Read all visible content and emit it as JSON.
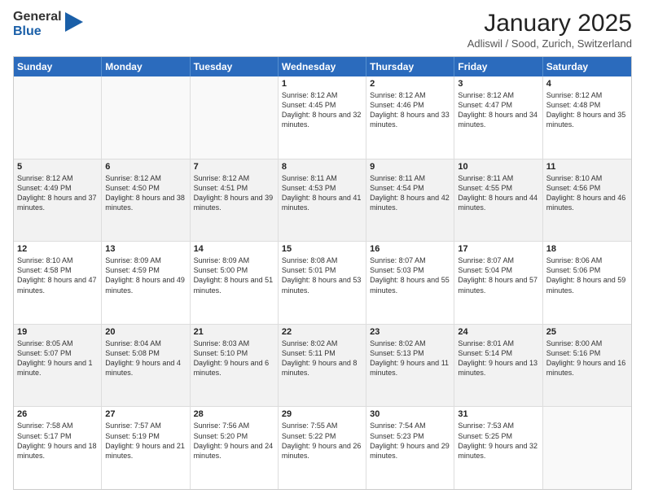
{
  "logo": {
    "general": "General",
    "blue": "Blue"
  },
  "header": {
    "title": "January 2025",
    "subtitle": "Adliswil / Sood, Zurich, Switzerland"
  },
  "weekdays": [
    "Sunday",
    "Monday",
    "Tuesday",
    "Wednesday",
    "Thursday",
    "Friday",
    "Saturday"
  ],
  "weeks": [
    [
      {
        "day": "",
        "info": "",
        "shaded": false,
        "empty": true
      },
      {
        "day": "",
        "info": "",
        "shaded": false,
        "empty": true
      },
      {
        "day": "",
        "info": "",
        "shaded": false,
        "empty": true
      },
      {
        "day": "1",
        "info": "Sunrise: 8:12 AM\nSunset: 4:45 PM\nDaylight: 8 hours\nand 32 minutes.",
        "shaded": false,
        "empty": false
      },
      {
        "day": "2",
        "info": "Sunrise: 8:12 AM\nSunset: 4:46 PM\nDaylight: 8 hours\nand 33 minutes.",
        "shaded": false,
        "empty": false
      },
      {
        "day": "3",
        "info": "Sunrise: 8:12 AM\nSunset: 4:47 PM\nDaylight: 8 hours\nand 34 minutes.",
        "shaded": false,
        "empty": false
      },
      {
        "day": "4",
        "info": "Sunrise: 8:12 AM\nSunset: 4:48 PM\nDaylight: 8 hours\nand 35 minutes.",
        "shaded": false,
        "empty": false
      }
    ],
    [
      {
        "day": "5",
        "info": "Sunrise: 8:12 AM\nSunset: 4:49 PM\nDaylight: 8 hours\nand 37 minutes.",
        "shaded": true,
        "empty": false
      },
      {
        "day": "6",
        "info": "Sunrise: 8:12 AM\nSunset: 4:50 PM\nDaylight: 8 hours\nand 38 minutes.",
        "shaded": true,
        "empty": false
      },
      {
        "day": "7",
        "info": "Sunrise: 8:12 AM\nSunset: 4:51 PM\nDaylight: 8 hours\nand 39 minutes.",
        "shaded": true,
        "empty": false
      },
      {
        "day": "8",
        "info": "Sunrise: 8:11 AM\nSunset: 4:53 PM\nDaylight: 8 hours\nand 41 minutes.",
        "shaded": true,
        "empty": false
      },
      {
        "day": "9",
        "info": "Sunrise: 8:11 AM\nSunset: 4:54 PM\nDaylight: 8 hours\nand 42 minutes.",
        "shaded": true,
        "empty": false
      },
      {
        "day": "10",
        "info": "Sunrise: 8:11 AM\nSunset: 4:55 PM\nDaylight: 8 hours\nand 44 minutes.",
        "shaded": true,
        "empty": false
      },
      {
        "day": "11",
        "info": "Sunrise: 8:10 AM\nSunset: 4:56 PM\nDaylight: 8 hours\nand 46 minutes.",
        "shaded": true,
        "empty": false
      }
    ],
    [
      {
        "day": "12",
        "info": "Sunrise: 8:10 AM\nSunset: 4:58 PM\nDaylight: 8 hours\nand 47 minutes.",
        "shaded": false,
        "empty": false
      },
      {
        "day": "13",
        "info": "Sunrise: 8:09 AM\nSunset: 4:59 PM\nDaylight: 8 hours\nand 49 minutes.",
        "shaded": false,
        "empty": false
      },
      {
        "day": "14",
        "info": "Sunrise: 8:09 AM\nSunset: 5:00 PM\nDaylight: 8 hours\nand 51 minutes.",
        "shaded": false,
        "empty": false
      },
      {
        "day": "15",
        "info": "Sunrise: 8:08 AM\nSunset: 5:01 PM\nDaylight: 8 hours\nand 53 minutes.",
        "shaded": false,
        "empty": false
      },
      {
        "day": "16",
        "info": "Sunrise: 8:07 AM\nSunset: 5:03 PM\nDaylight: 8 hours\nand 55 minutes.",
        "shaded": false,
        "empty": false
      },
      {
        "day": "17",
        "info": "Sunrise: 8:07 AM\nSunset: 5:04 PM\nDaylight: 8 hours\nand 57 minutes.",
        "shaded": false,
        "empty": false
      },
      {
        "day": "18",
        "info": "Sunrise: 8:06 AM\nSunset: 5:06 PM\nDaylight: 8 hours\nand 59 minutes.",
        "shaded": false,
        "empty": false
      }
    ],
    [
      {
        "day": "19",
        "info": "Sunrise: 8:05 AM\nSunset: 5:07 PM\nDaylight: 9 hours\nand 1 minute.",
        "shaded": true,
        "empty": false
      },
      {
        "day": "20",
        "info": "Sunrise: 8:04 AM\nSunset: 5:08 PM\nDaylight: 9 hours\nand 4 minutes.",
        "shaded": true,
        "empty": false
      },
      {
        "day": "21",
        "info": "Sunrise: 8:03 AM\nSunset: 5:10 PM\nDaylight: 9 hours\nand 6 minutes.",
        "shaded": true,
        "empty": false
      },
      {
        "day": "22",
        "info": "Sunrise: 8:02 AM\nSunset: 5:11 PM\nDaylight: 9 hours\nand 8 minutes.",
        "shaded": true,
        "empty": false
      },
      {
        "day": "23",
        "info": "Sunrise: 8:02 AM\nSunset: 5:13 PM\nDaylight: 9 hours\nand 11 minutes.",
        "shaded": true,
        "empty": false
      },
      {
        "day": "24",
        "info": "Sunrise: 8:01 AM\nSunset: 5:14 PM\nDaylight: 9 hours\nand 13 minutes.",
        "shaded": true,
        "empty": false
      },
      {
        "day": "25",
        "info": "Sunrise: 8:00 AM\nSunset: 5:16 PM\nDaylight: 9 hours\nand 16 minutes.",
        "shaded": true,
        "empty": false
      }
    ],
    [
      {
        "day": "26",
        "info": "Sunrise: 7:58 AM\nSunset: 5:17 PM\nDaylight: 9 hours\nand 18 minutes.",
        "shaded": false,
        "empty": false
      },
      {
        "day": "27",
        "info": "Sunrise: 7:57 AM\nSunset: 5:19 PM\nDaylight: 9 hours\nand 21 minutes.",
        "shaded": false,
        "empty": false
      },
      {
        "day": "28",
        "info": "Sunrise: 7:56 AM\nSunset: 5:20 PM\nDaylight: 9 hours\nand 24 minutes.",
        "shaded": false,
        "empty": false
      },
      {
        "day": "29",
        "info": "Sunrise: 7:55 AM\nSunset: 5:22 PM\nDaylight: 9 hours\nand 26 minutes.",
        "shaded": false,
        "empty": false
      },
      {
        "day": "30",
        "info": "Sunrise: 7:54 AM\nSunset: 5:23 PM\nDaylight: 9 hours\nand 29 minutes.",
        "shaded": false,
        "empty": false
      },
      {
        "day": "31",
        "info": "Sunrise: 7:53 AM\nSunset: 5:25 PM\nDaylight: 9 hours\nand 32 minutes.",
        "shaded": false,
        "empty": false
      },
      {
        "day": "",
        "info": "",
        "shaded": false,
        "empty": true
      }
    ]
  ]
}
